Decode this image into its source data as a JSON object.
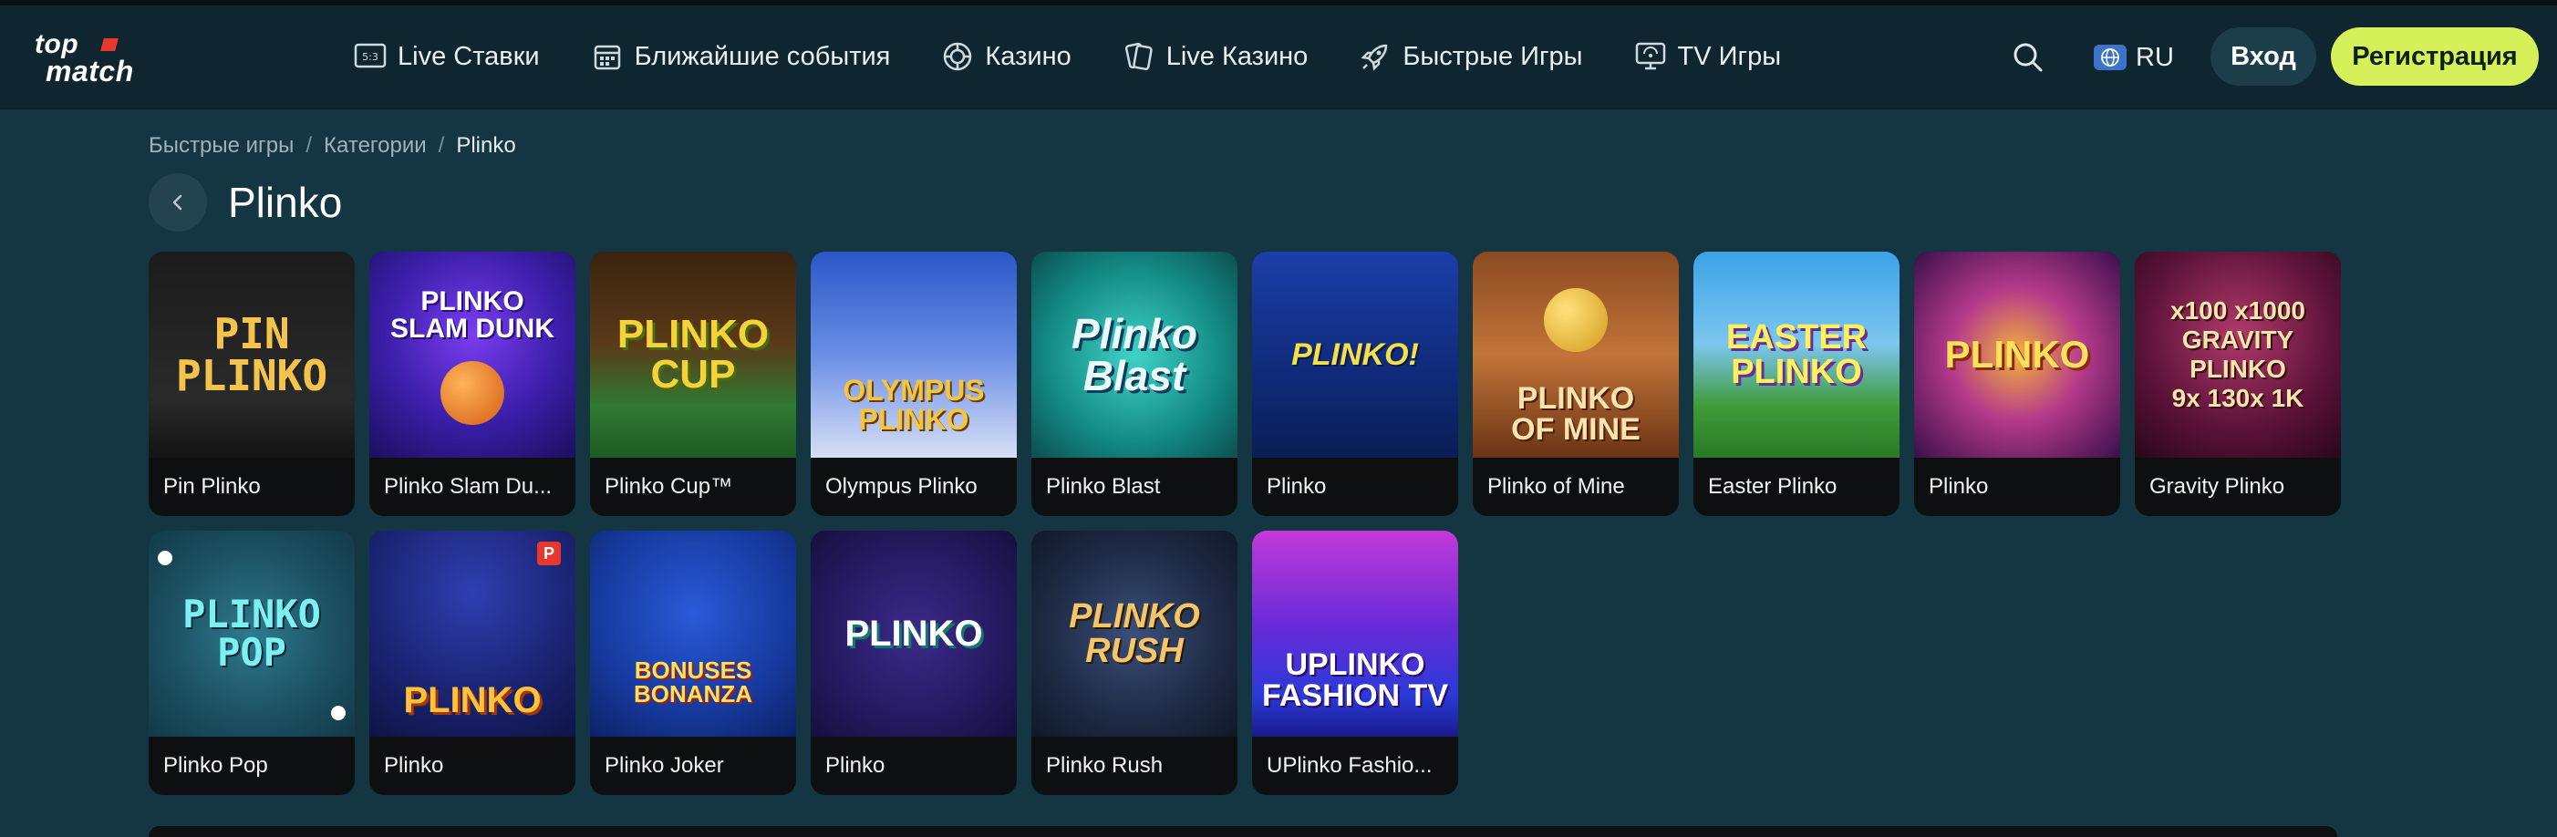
{
  "header": {
    "logo_top": "top",
    "logo_bottom": "match",
    "nav": [
      {
        "label": "Live Ставки",
        "icon": "live-bets-icon"
      },
      {
        "label": "Ближайшие события",
        "icon": "calendar-icon"
      },
      {
        "label": "Казино",
        "icon": "casino-chip-icon"
      },
      {
        "label": "Live Казино",
        "icon": "cards-icon"
      },
      {
        "label": "Быстрые Игры",
        "icon": "rocket-icon"
      },
      {
        "label": "TV Игры",
        "icon": "tv-icon"
      }
    ],
    "lang": "RU",
    "login": "Вход",
    "register": "Регистрация",
    "accent_color": "#d6f05a"
  },
  "breadcrumb": {
    "items": [
      "Быстрые игры",
      "Категории"
    ],
    "current": "Plinko",
    "separator": "/"
  },
  "page_title": "Plinko",
  "games": [
    {
      "label": "Pin Plinko",
      "art": "PIN\nPLINKO"
    },
    {
      "label": "Plinko Slam Du...",
      "art": "PLINKO\nSLAM DUNK"
    },
    {
      "label": "Plinko Cup™",
      "art": "PLINKO\nCUP"
    },
    {
      "label": "Olympus Plinko",
      "art": "OLYMPUS\nPLINKO"
    },
    {
      "label": "Plinko Blast",
      "art": "Plinko\nBlast"
    },
    {
      "label": "Plinko",
      "art": "PLINKO!"
    },
    {
      "label": "Plinko of Mine",
      "art": "PLINKO\nOF MINE"
    },
    {
      "label": "Easter Plinko",
      "art": "EASTER\nPLINKO"
    },
    {
      "label": "Plinko",
      "art": "PLINKO"
    },
    {
      "label": "Gravity Plinko",
      "art": "x100 x1000\nGRAVITY\nPLINKO\n9x 130x 1K"
    },
    {
      "label": "Plinko Pop",
      "art": "PLINKO\nPOP"
    },
    {
      "label": "Plinko",
      "art": "PLINKO"
    },
    {
      "label": "Plinko Joker",
      "art": "BONUSES\nBONANZA"
    },
    {
      "label": "Plinko",
      "art": "PLINKO"
    },
    {
      "label": "Plinko Rush",
      "art": "PLINKO\nRUSH"
    },
    {
      "label": "UPlinko Fashio...",
      "art": "UPLINKO\nFASHION TV"
    }
  ]
}
